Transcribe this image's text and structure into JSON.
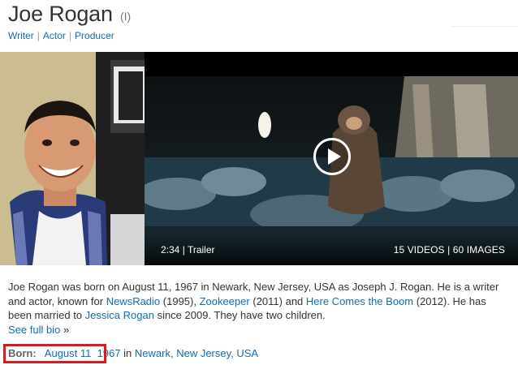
{
  "person": {
    "name": "Joe Rogan",
    "name_suffix": "(I)"
  },
  "jobs": [
    {
      "label": "Writer"
    },
    {
      "label": "Actor"
    },
    {
      "label": "Producer"
    }
  ],
  "job_separator": "|",
  "video": {
    "duration": "2:34",
    "duration_sep": "|",
    "type_label": "Trailer",
    "counts": "15 VIDEOS | 60 IMAGES"
  },
  "bio": {
    "p1": "Joe Rogan was born on August 11, 1967 in Newark, New Jersey, USA as Joseph J. Rogan. He is a writer and actor, known for ",
    "link1": "NewsRadio",
    "p2": " (1995), ",
    "link2": "Zookeeper",
    "p3": " (2011) and ",
    "link3": "Here Comes the Boom",
    "p4": " (2012). He has been married to ",
    "link4": "Jessica Rogan",
    "p5": " since 2009. They have two children.",
    "see_full_bio": "See full bio",
    "see_full_bio_arrow": "»"
  },
  "born": {
    "label": "Born:",
    "date": "August 11",
    "year": "1967",
    "in_word": "in",
    "place": "Newark, New Jersey, USA"
  },
  "colors": {
    "link": "#136cb2",
    "highlight": "#e0161e"
  }
}
